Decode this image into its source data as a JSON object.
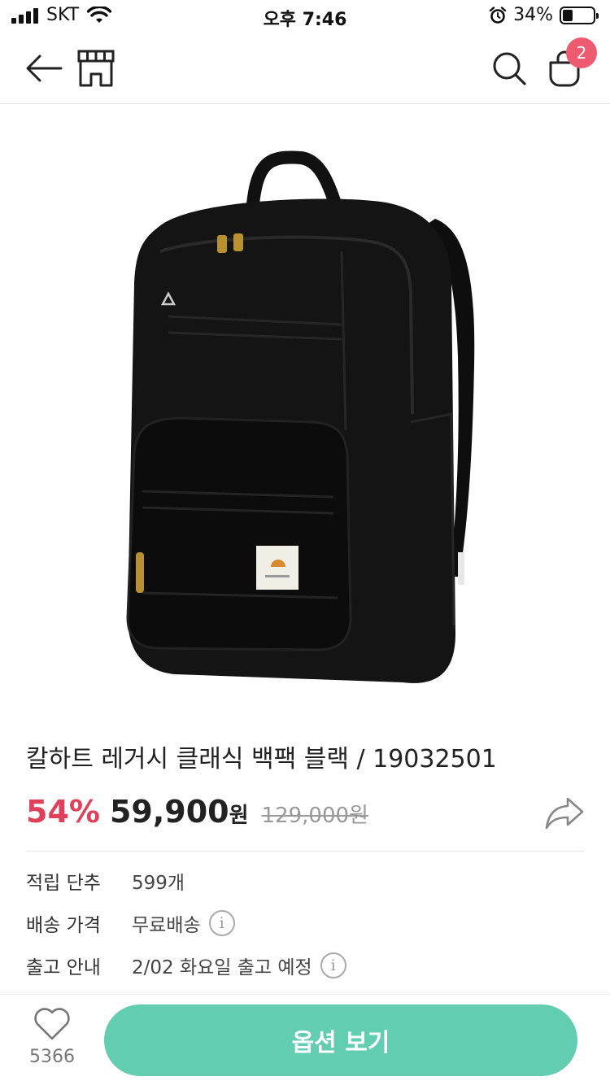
{
  "status_bar": {
    "carrier": "SKT",
    "time": "오후 7:46",
    "battery_percent_text": "34%",
    "battery_level": 0.34
  },
  "nav": {
    "cart_count": "2",
    "icons": [
      "back-arrow-icon",
      "store-icon",
      "search-icon",
      "shopping-bag-icon"
    ]
  },
  "product": {
    "name": "칼하트 레거시 클래식 백팩 블랙 / 19032501",
    "discount": "54%",
    "price": "59,900",
    "price_unit": "원",
    "original_price": "129,000원"
  },
  "info": {
    "points_label": "적립 단추",
    "points_value": "599개",
    "shipping_label": "배송 가격",
    "shipping_value": "무료배송",
    "release_label": "출고 안내",
    "release_value": "2/02 화요일 출고 예정",
    "info_icon_glyph": "i"
  },
  "bottom": {
    "like_count": "5366",
    "options_label": "옵션 보기"
  },
  "colors": {
    "accent": "#62cdb1",
    "discount": "#e0415a",
    "badge": "#ee5a6f"
  }
}
